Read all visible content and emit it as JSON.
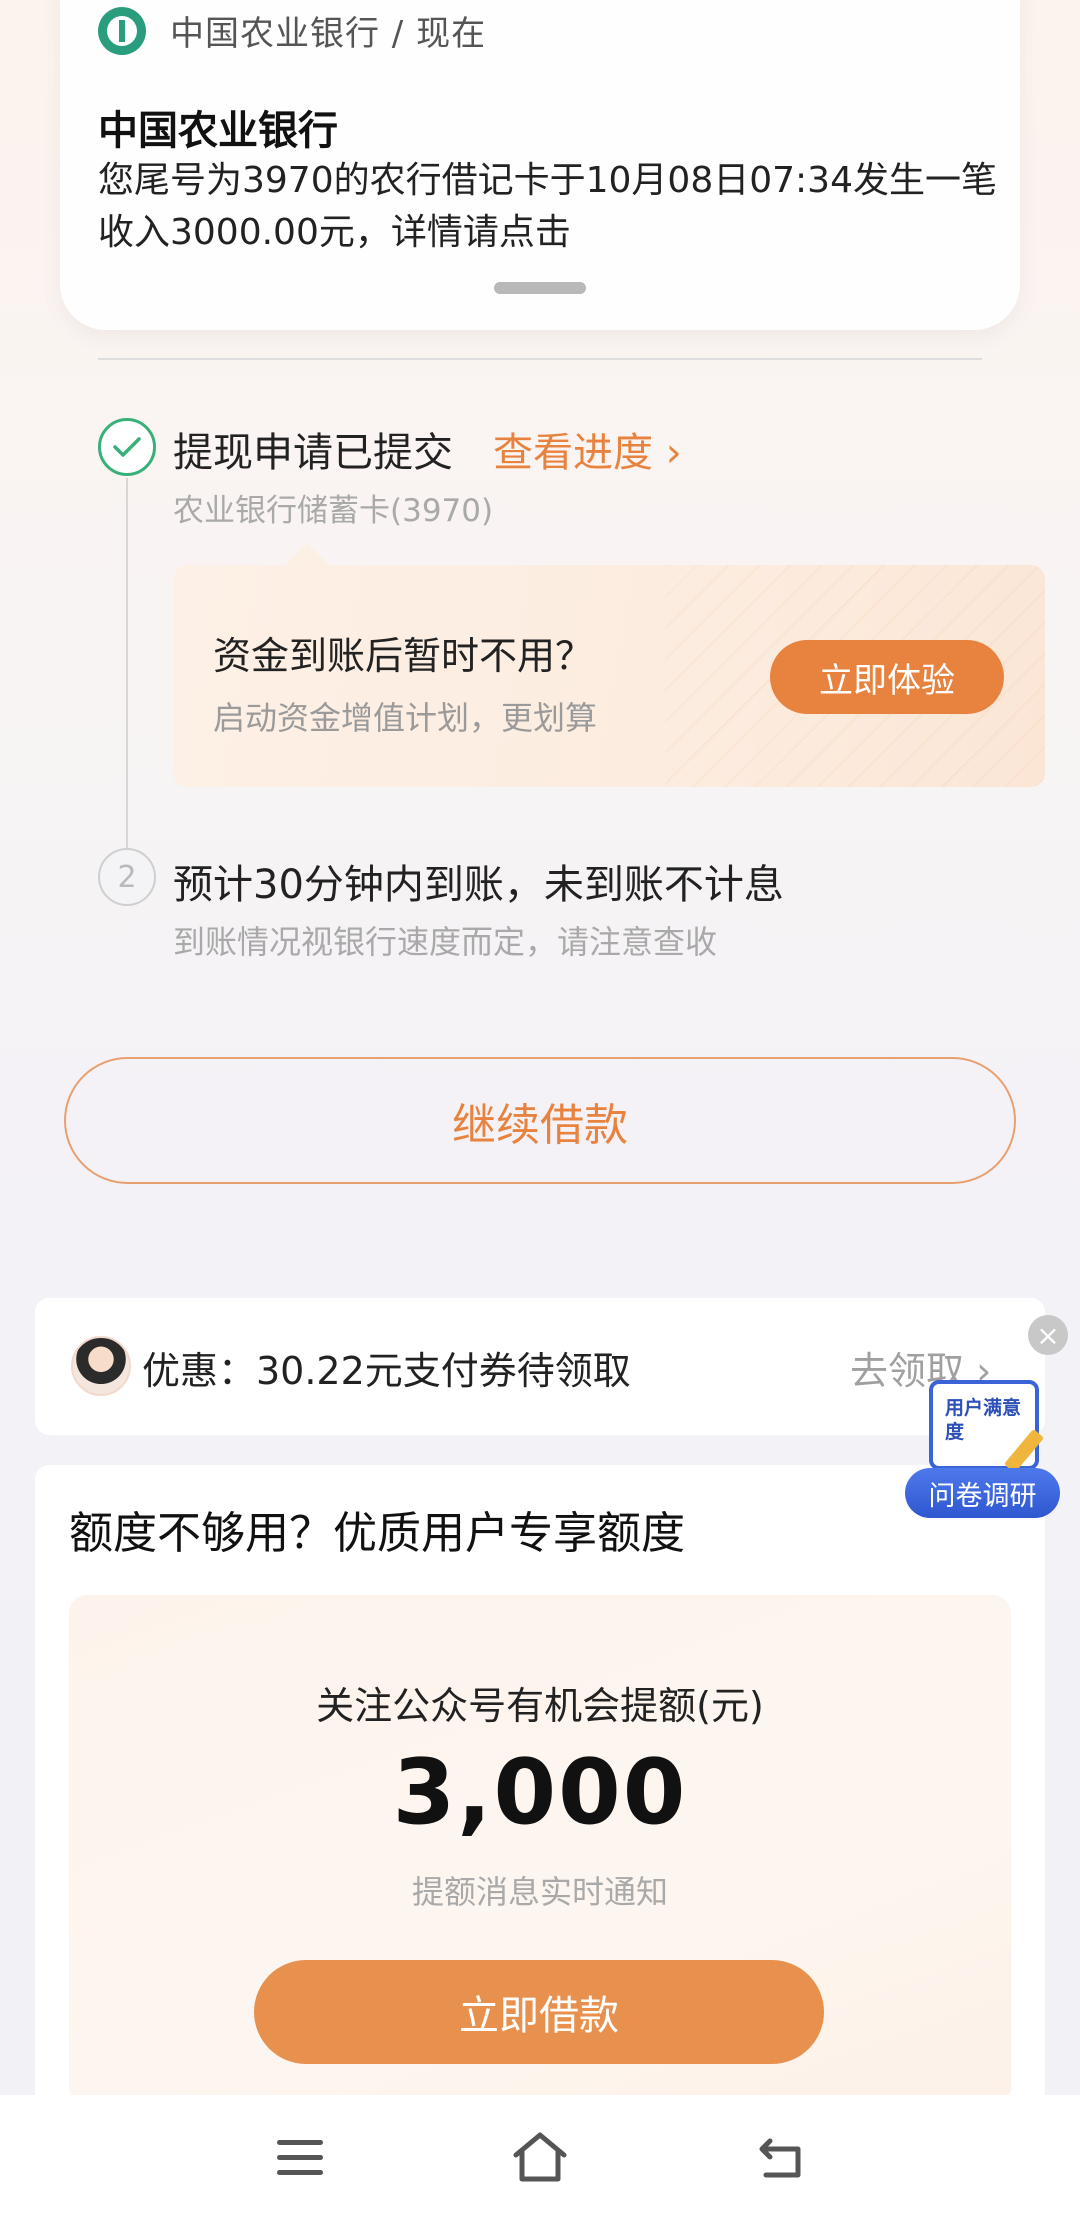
{
  "notification": {
    "source": "中国农业银行 / 现在",
    "title": "中国农业银行",
    "body": "您尾号为3970的农行借记卡于10月08日07:34发生一笔收入3000.00元，详情请点击"
  },
  "steps": {
    "step1": {
      "title": "提现申请已提交",
      "link": "查看进度 ›",
      "sub": "农业银行储蓄卡(3970)"
    },
    "promo": {
      "question": "资金到账后暂时不用？",
      "sub": "启动资金增值计划，更划算",
      "button": "立即体验"
    },
    "step2": {
      "number": "2",
      "title": "预计30分钟内到账，未到账不计息",
      "sub": "到账情况视银行速度而定，请注意查收"
    }
  },
  "continue_button": "继续借款",
  "coupon": {
    "text": "优惠：30.22元支付券待领取",
    "link": "去领取 ›"
  },
  "survey": {
    "card_text": "用户满意度",
    "pill": "问卷调研",
    "close": "×"
  },
  "credit": {
    "title": "额度不够用？优质用户专享额度",
    "label": "关注公众号有机会提额(元)",
    "amount": "3,000",
    "note": "提额消息实时通知",
    "button": "立即借款"
  },
  "colors": {
    "accent": "#e8833f",
    "success": "#38b07a",
    "survey_blue": "#3a63d8"
  }
}
